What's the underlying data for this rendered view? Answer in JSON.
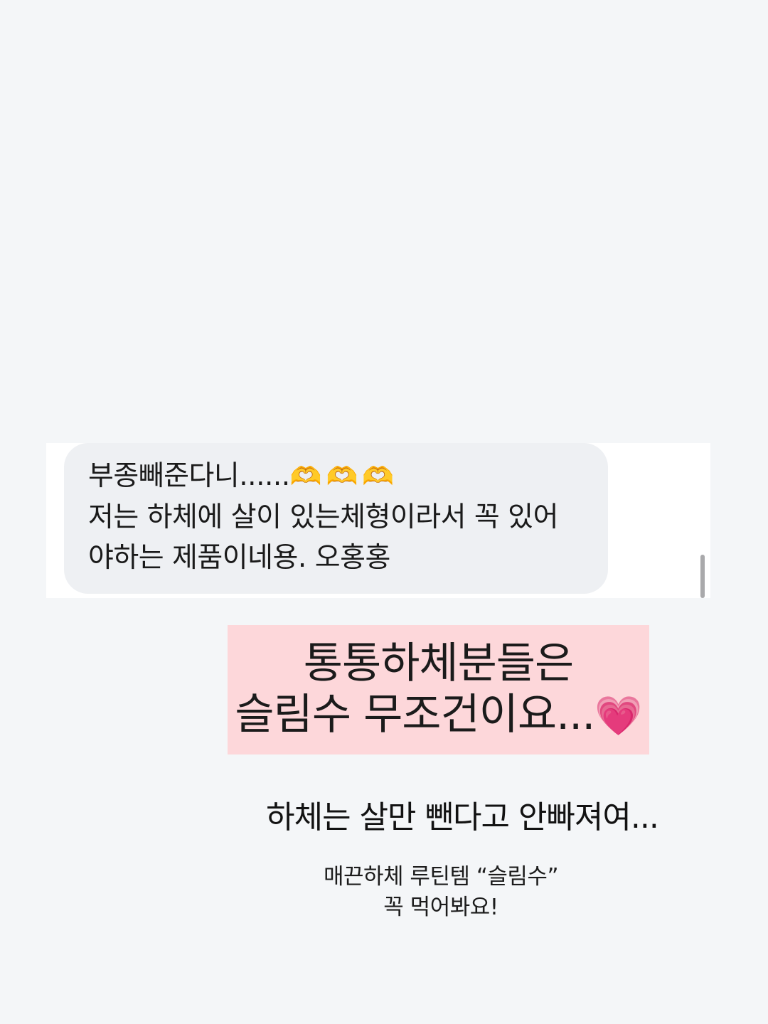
{
  "chat": {
    "line1_text": "부종빼준다니......",
    "line1_emoji": "🫶🫶🫶",
    "line2": "저는 하체에 살이 있는체형이라서 꼭 있어",
    "line3": "야하는 제품이네용. 오홍홍"
  },
  "highlight": {
    "line1": "통통하체분들은",
    "line2_text": "슬림수 무조건이요...",
    "heart_icon": "💗",
    "background_color": "#fdd7da"
  },
  "subheadline": "하체는 살만 뺀다고 안빠져여...",
  "caption": {
    "line1": "매끈하체 루틴템 “슬림수”",
    "line2": "꼭 먹어봐요!"
  }
}
